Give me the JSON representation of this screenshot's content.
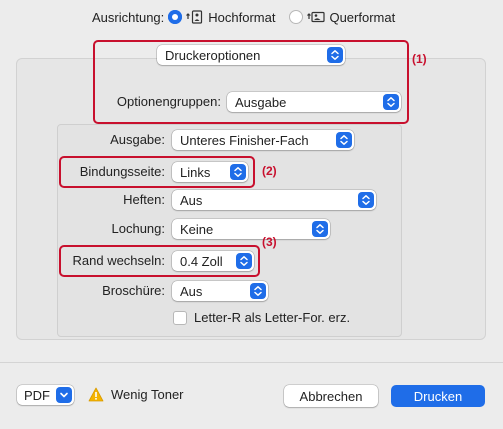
{
  "orientation": {
    "label": "Ausrichtung:",
    "portrait": "Hochformat",
    "landscape": "Querformat",
    "selected": "portrait"
  },
  "section": {
    "printer_options": "Druckeroptionen",
    "option_groups_label": "Optionengruppen:",
    "option_groups_value": "Ausgabe"
  },
  "fields": {
    "output_label": "Ausgabe:",
    "output_value": "Unteres Finisher-Fach",
    "binding_label": "Bindungsseite:",
    "binding_value": "Links",
    "staple_label": "Heften:",
    "staple_value": "Aus",
    "punch_label": "Lochung:",
    "punch_value": "Keine",
    "margin_label": "Rand wechseln:",
    "margin_value": "0.4 Zoll",
    "booklet_label": "Broschüre:",
    "booklet_value": "Aus",
    "letter_r_checkbox": "Letter-R als Letter-For. erz.",
    "letter_r_checked": false
  },
  "annotations": {
    "a1": "(1)",
    "a2": "(2)",
    "a3": "(3)",
    "color": "#c8102e"
  },
  "footer": {
    "pdf_label": "PDF",
    "warning_text": "Wenig Toner",
    "cancel_label": "Abbrechen",
    "print_label": "Drucken"
  },
  "colors": {
    "accent": "#1f6de8",
    "warning": "#f5b400"
  }
}
